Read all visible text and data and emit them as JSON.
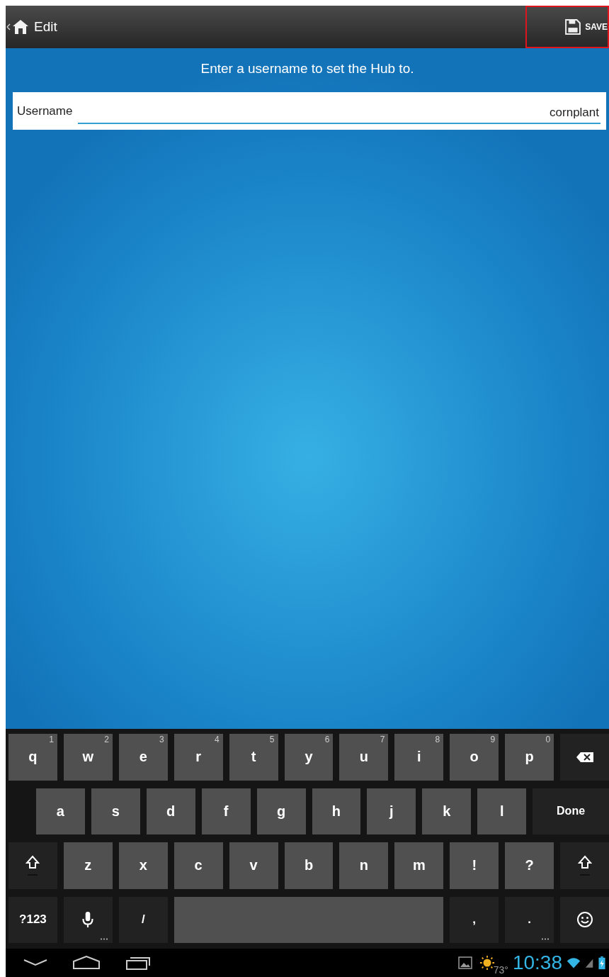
{
  "action_bar": {
    "title": "Edit",
    "save": {
      "label": "SAVE",
      "highlighted": true
    }
  },
  "prompt": "Enter a username to set the Hub to.",
  "field": {
    "label": "Username",
    "value": "cornplant"
  },
  "keyboard": {
    "rows": [
      {
        "keys": [
          {
            "kind": "letter",
            "label": "q",
            "hint": "1"
          },
          {
            "kind": "letter",
            "label": "w",
            "hint": "2"
          },
          {
            "kind": "letter",
            "label": "e",
            "hint": "3"
          },
          {
            "kind": "letter",
            "label": "r",
            "hint": "4"
          },
          {
            "kind": "letter",
            "label": "t",
            "hint": "5"
          },
          {
            "kind": "letter",
            "label": "y",
            "hint": "6"
          },
          {
            "kind": "letter",
            "label": "u",
            "hint": "7"
          },
          {
            "kind": "letter",
            "label": "i",
            "hint": "8"
          },
          {
            "kind": "letter",
            "label": "o",
            "hint": "9"
          },
          {
            "kind": "letter",
            "label": "p",
            "hint": "0"
          },
          {
            "kind": "backspace"
          }
        ]
      },
      {
        "keys": [
          {
            "kind": "letter",
            "label": "a"
          },
          {
            "kind": "letter",
            "label": "s"
          },
          {
            "kind": "letter",
            "label": "d"
          },
          {
            "kind": "letter",
            "label": "f"
          },
          {
            "kind": "letter",
            "label": "g"
          },
          {
            "kind": "letter",
            "label": "h"
          },
          {
            "kind": "letter",
            "label": "j"
          },
          {
            "kind": "letter",
            "label": "k"
          },
          {
            "kind": "letter",
            "label": "l"
          },
          {
            "kind": "action",
            "label": "Done"
          }
        ]
      },
      {
        "keys": [
          {
            "kind": "shift"
          },
          {
            "kind": "letter",
            "label": "z"
          },
          {
            "kind": "letter",
            "label": "x"
          },
          {
            "kind": "letter",
            "label": "c"
          },
          {
            "kind": "letter",
            "label": "v"
          },
          {
            "kind": "letter",
            "label": "b"
          },
          {
            "kind": "letter",
            "label": "n"
          },
          {
            "kind": "letter",
            "label": "m"
          },
          {
            "kind": "letter",
            "label": "!"
          },
          {
            "kind": "letter",
            "label": "?"
          },
          {
            "kind": "shift"
          }
        ]
      },
      {
        "keys": [
          {
            "kind": "function",
            "label": "?123"
          },
          {
            "kind": "mic",
            "more": true
          },
          {
            "kind": "function",
            "label": "/"
          },
          {
            "kind": "space"
          },
          {
            "kind": "function",
            "label": ","
          },
          {
            "kind": "function",
            "label": ".",
            "more": true
          },
          {
            "kind": "emoji"
          }
        ]
      }
    ]
  },
  "status_bar": {
    "temperature": "73°",
    "time": "10:38"
  }
}
